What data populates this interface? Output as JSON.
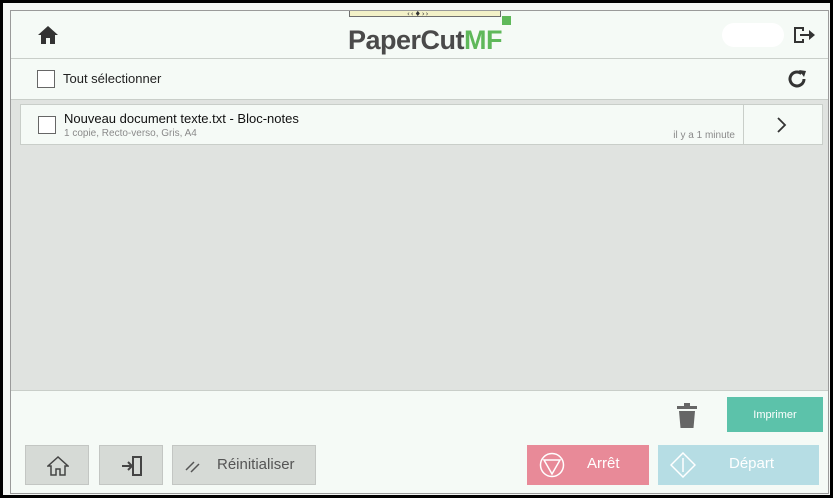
{
  "header": {
    "logo_main": "PaperCut",
    "logo_accent": "MF",
    "handle_glyph": "‹‹♦››",
    "home_icon": "home-icon",
    "logout_icon": "logout-icon"
  },
  "selection": {
    "select_all_label": "Tout sélectionner",
    "refresh_icon": "refresh-icon"
  },
  "jobs": [
    {
      "title": "Nouveau document texte.txt - Bloc-notes",
      "details": "1 copie, Recto-verso, Gris, A4",
      "time": "il y a 1 minute"
    }
  ],
  "actions": {
    "print_label": "Imprimer",
    "delete_icon": "trash-icon"
  },
  "footer": {
    "reset_label": "Réinitialiser",
    "stop_label": "Arrêt",
    "start_label": "Départ"
  },
  "colors": {
    "print": "#5cc2aa",
    "stop": "#e88a98",
    "start": "#b6dde4",
    "brand_green": "#5fb85a"
  }
}
